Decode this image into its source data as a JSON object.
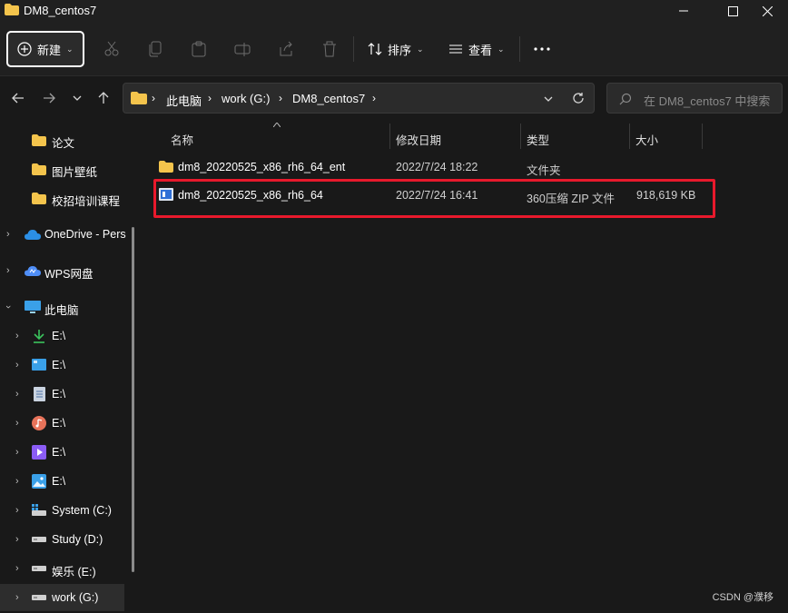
{
  "window": {
    "title": "DM8_centos7",
    "controls": [
      "minimize",
      "maximize",
      "close"
    ]
  },
  "toolbar": {
    "new_label": "新建",
    "sort_label": "排序",
    "view_label": "查看",
    "icons": [
      "cut-icon",
      "copy-icon",
      "paste-icon",
      "rename-icon",
      "share-icon",
      "delete-icon"
    ]
  },
  "address": {
    "crumbs": [
      "此电脑",
      "work (G:)",
      "DM8_centos7"
    ],
    "search_placeholder": "在 DM8_centos7 中搜索"
  },
  "sidebar": {
    "quick_access": [
      {
        "label": "论文"
      },
      {
        "label": "图片壁纸"
      },
      {
        "label": "校招培训课程"
      }
    ],
    "onedrive": "OneDrive - Pers",
    "wps": "WPS网盘",
    "this_pc": "此电脑",
    "drives": [
      {
        "label": "E:\\",
        "icon": "download-icon"
      },
      {
        "label": "E:\\",
        "icon": "desktop-icon"
      },
      {
        "label": "E:\\",
        "icon": "document-icon"
      },
      {
        "label": "E:\\",
        "icon": "music-icon"
      },
      {
        "label": "E:\\",
        "icon": "video-icon"
      },
      {
        "label": "E:\\",
        "icon": "picture-icon"
      },
      {
        "label": "System (C:)",
        "icon": "system-drive-icon"
      },
      {
        "label": "Study (D:)",
        "icon": "drive-icon"
      },
      {
        "label": "娱乐 (E:)",
        "icon": "drive-icon"
      },
      {
        "label": "work (G:)",
        "icon": "drive-icon"
      }
    ]
  },
  "columns": {
    "name": "名称",
    "modified": "修改日期",
    "type": "类型",
    "size": "大小"
  },
  "files": [
    {
      "name": "dm8_20220525_x86_rh6_64_ent",
      "modified": "2022/7/24 18:22",
      "type": "文件夹",
      "size": "",
      "icon": "folder-icon"
    },
    {
      "name": "dm8_20220525_x86_rh6_64",
      "modified": "2022/7/24 16:41",
      "type": "360压缩 ZIP 文件",
      "size": "918,619 KB",
      "icon": "zip-file-icon"
    }
  ],
  "watermark": "CSDN @濮移",
  "colors": {
    "background": "#191919",
    "chrome": "#202020",
    "highlight_border": "#e8192c",
    "folder": "#f4c44c"
  }
}
